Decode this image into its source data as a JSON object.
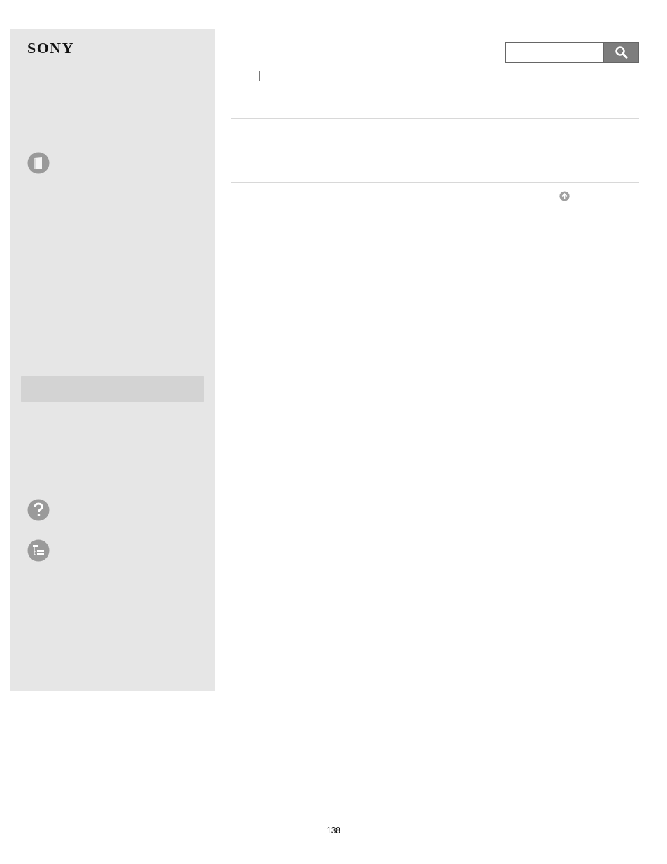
{
  "logo": "SONY",
  "page_number": "138"
}
